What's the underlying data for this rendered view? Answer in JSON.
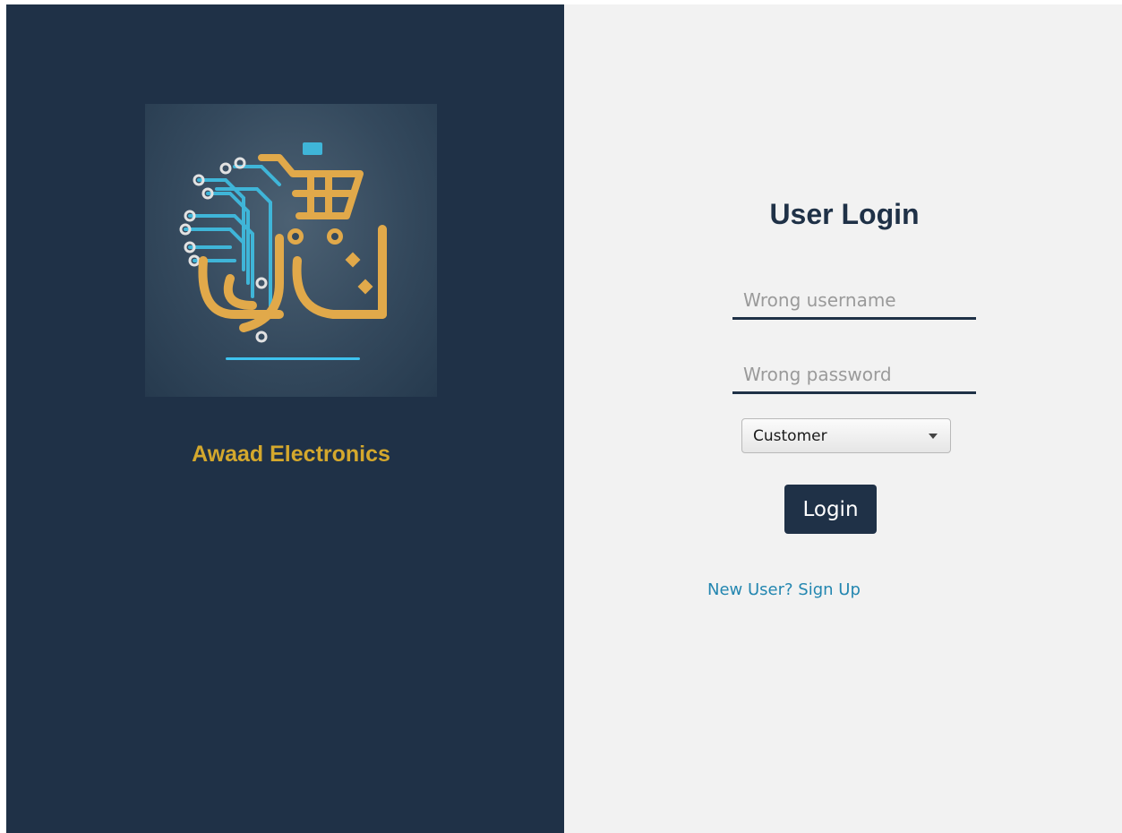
{
  "brand": {
    "name": "Awaad Electronics",
    "logo_icon": "shopping-cart-circuit-logo"
  },
  "login": {
    "title": "User Login",
    "username_placeholder": "Wrong username",
    "username_value": "",
    "password_placeholder": "Wrong password",
    "password_value": "",
    "role_selected": "Customer",
    "button_label": "Login",
    "signup_link": "New User? Sign Up"
  },
  "colors": {
    "panel_dark": "#1f3147",
    "panel_light": "#f2f2f2",
    "brand_gold": "#d4a82d",
    "link_blue": "#2386b0"
  }
}
